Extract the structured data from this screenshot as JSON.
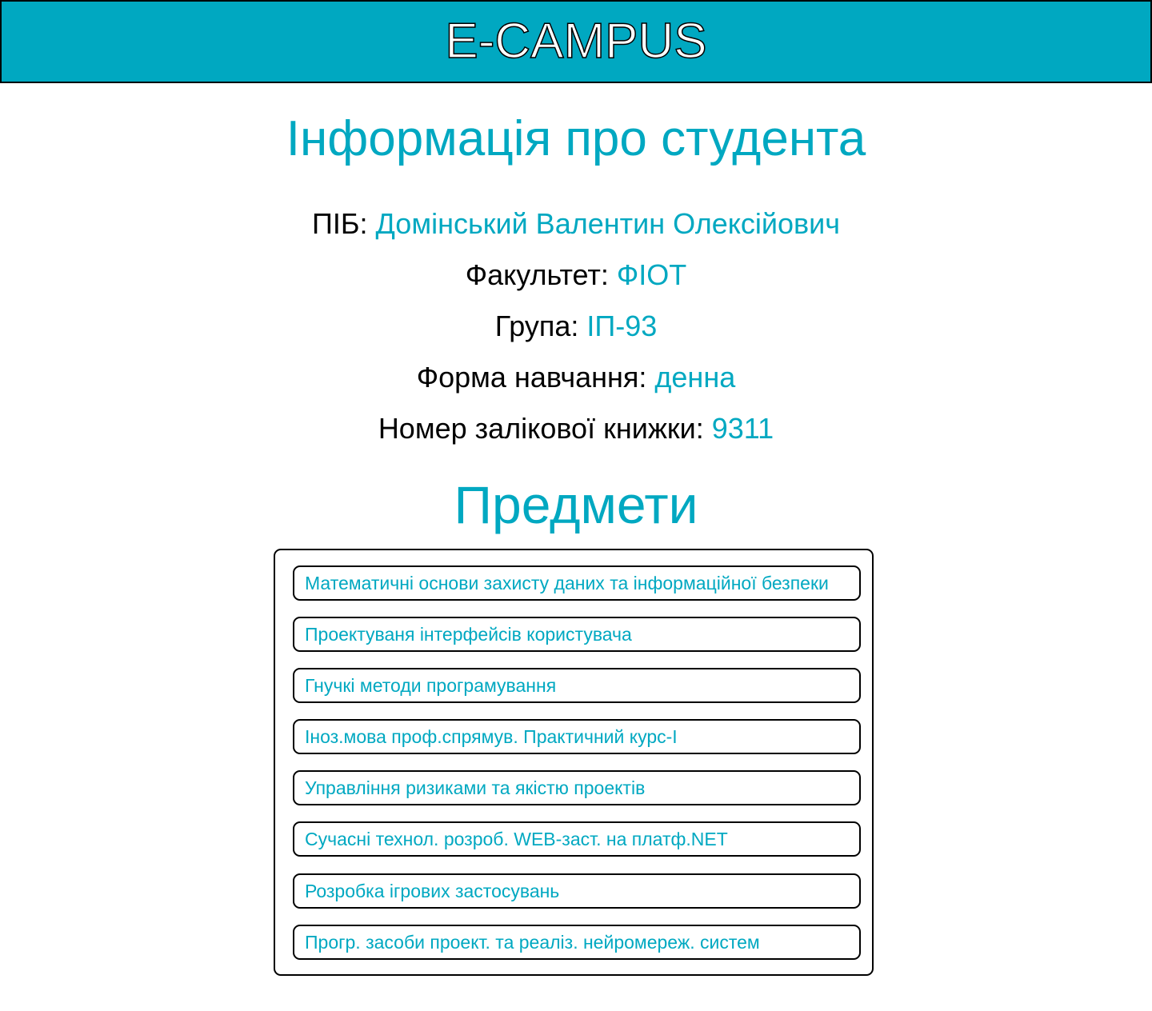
{
  "header": {
    "title": "E-CAMPUS"
  },
  "student_info": {
    "title": "Інформація про студента",
    "rows": [
      {
        "label": "ПІБ: ",
        "value": "Домінський Валентин Олексійович"
      },
      {
        "label": "Факультет: ",
        "value": "ФІОТ"
      },
      {
        "label": "Група: ",
        "value": "ІП-93"
      },
      {
        "label": "Форма навчання: ",
        "value": "денна"
      },
      {
        "label": "Номер залікової книжки: ",
        "value": "9311"
      }
    ]
  },
  "subjects": {
    "title": "Предмети",
    "items": [
      "Математичні основи захисту даних та інформаційної безпеки",
      "Проектуваня інтерфейсів користувача",
      "Гнучкі методи програмування",
      "Іноз.мова проф.спрямув. Практичний курс-І",
      "Управління ризиками та якістю проектів",
      "Сучасні технол. розроб. WEB-заст. на платф.NET",
      "Розробка ігрових застосувань",
      "Прогр. засоби проект. та реаліз. нейромереж. систем"
    ]
  },
  "colors": {
    "accent": "#00a8c1",
    "border": "#000000",
    "background": "#ffffff"
  }
}
